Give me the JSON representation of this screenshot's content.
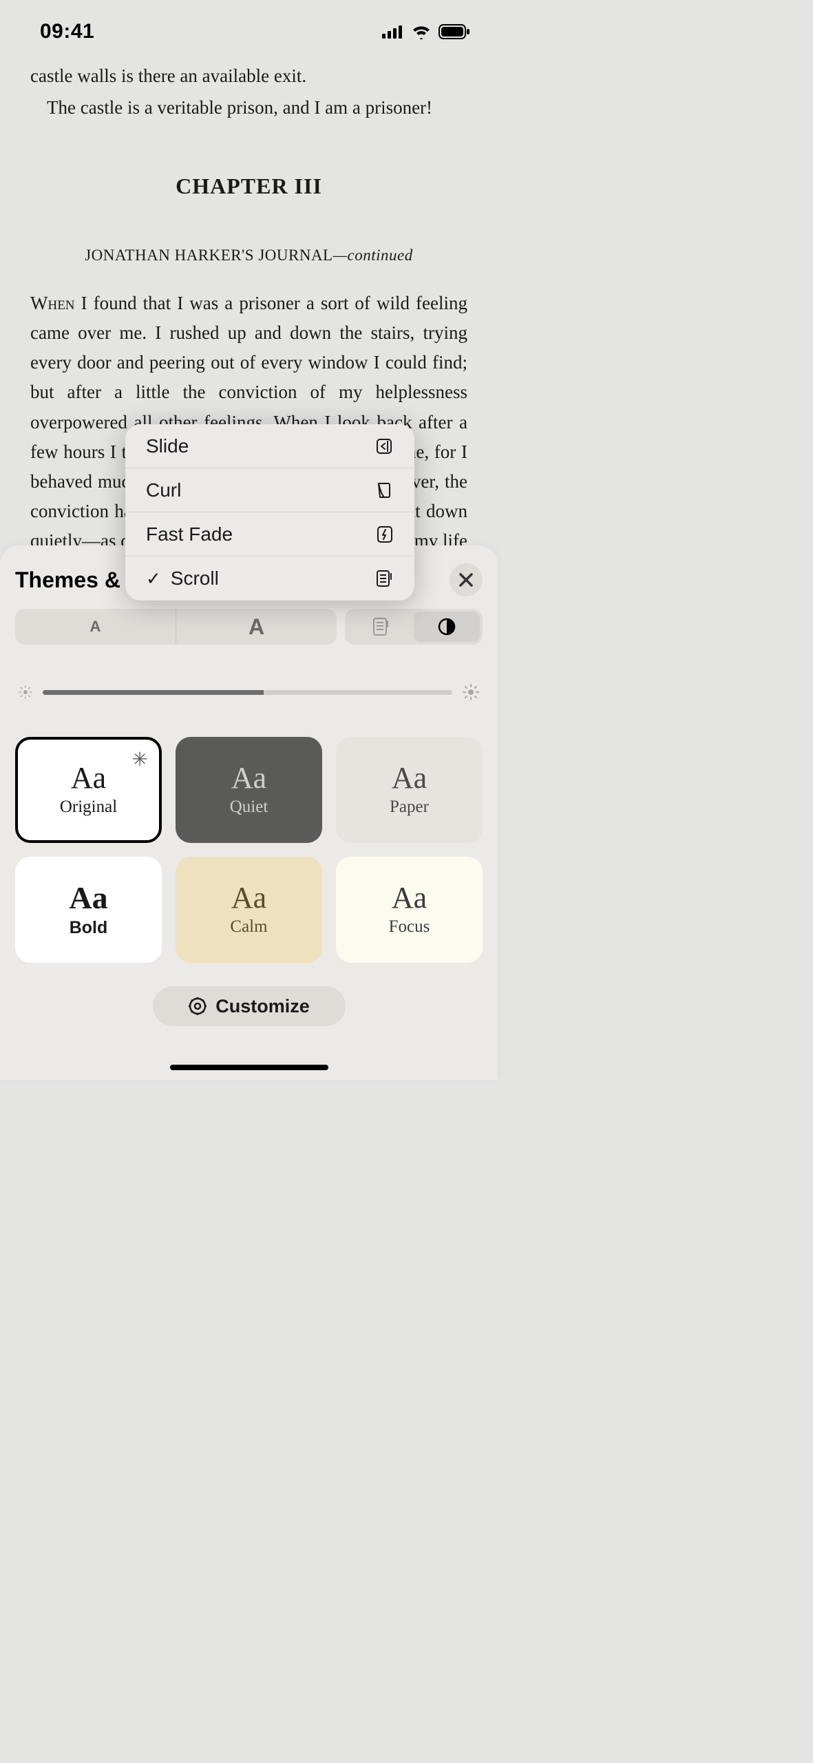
{
  "status": {
    "time": "09:41"
  },
  "book": {
    "para_end_line1": "castle walls is there an available exit.",
    "para_end_line2": "The castle is a veritable prison, and I am a prisoner!",
    "chapter_title": "CHAPTER III",
    "subtitle_main": "JONATHAN HARKER'S JOURNAL",
    "subtitle_tail": "—continued",
    "body_first_word": "When",
    "body_rest": " I found that I was a prisoner a sort of wild feeling came over me. I rushed up and down the stairs, trying every door and peering out of every window I could find; but after a little the conviction of my helplessness overpowered all other feelings. When I look back after a few hours I think I must have been mad for the time, for I behaved much as a rat does in a trap. When, however, the conviction had come to me that I was helpless I sat down quietly—as quietly as I have ever done anything in my life—and began to think over what was best to be done. I am thinking still, and as yet have come to no definite conclusion. Of one thing only am I certain; that it is no use making my ideas known to the Count. He knows well that I am imprisoned; and as he has done it himself, and has doubtless his own motives for it, he would only deceive me if I trusted him fully with the facts. So far"
  },
  "popover": {
    "items": [
      {
        "label": "Slide",
        "icon": "slide-icon",
        "selected": false
      },
      {
        "label": "Curl",
        "icon": "curl-icon",
        "selected": false
      },
      {
        "label": "Fast Fade",
        "icon": "fastfade-icon",
        "selected": false
      },
      {
        "label": "Scroll",
        "icon": "scroll-icon",
        "selected": true
      }
    ]
  },
  "panel": {
    "title": "Themes &",
    "font_smaller": "A",
    "font_larger": "A",
    "brightness_percent": 54,
    "themes": [
      {
        "name": "Original",
        "starred": true
      },
      {
        "name": "Quiet"
      },
      {
        "name": "Paper"
      },
      {
        "name": "Bold"
      },
      {
        "name": "Calm"
      },
      {
        "name": "Focus"
      }
    ],
    "customize_label": "Customize"
  }
}
